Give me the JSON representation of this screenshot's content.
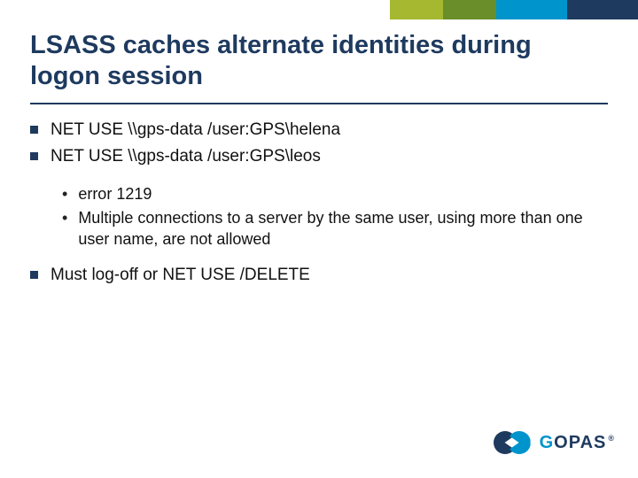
{
  "title": "LSASS caches alternate identities during logon session",
  "bullets": {
    "b1": "NET USE \\\\gps-data /user:GPS\\helena",
    "b2": "NET USE \\\\gps-data /user:GPS\\leos",
    "sub1": "error 1219",
    "sub2": "Multiple connections to a server by the same user, using more than one user name, are not allowed",
    "b3": "Must log-off or NET USE /DELETE"
  },
  "logo": {
    "g": "G",
    "opas": "OPAS",
    "reg": "®"
  }
}
